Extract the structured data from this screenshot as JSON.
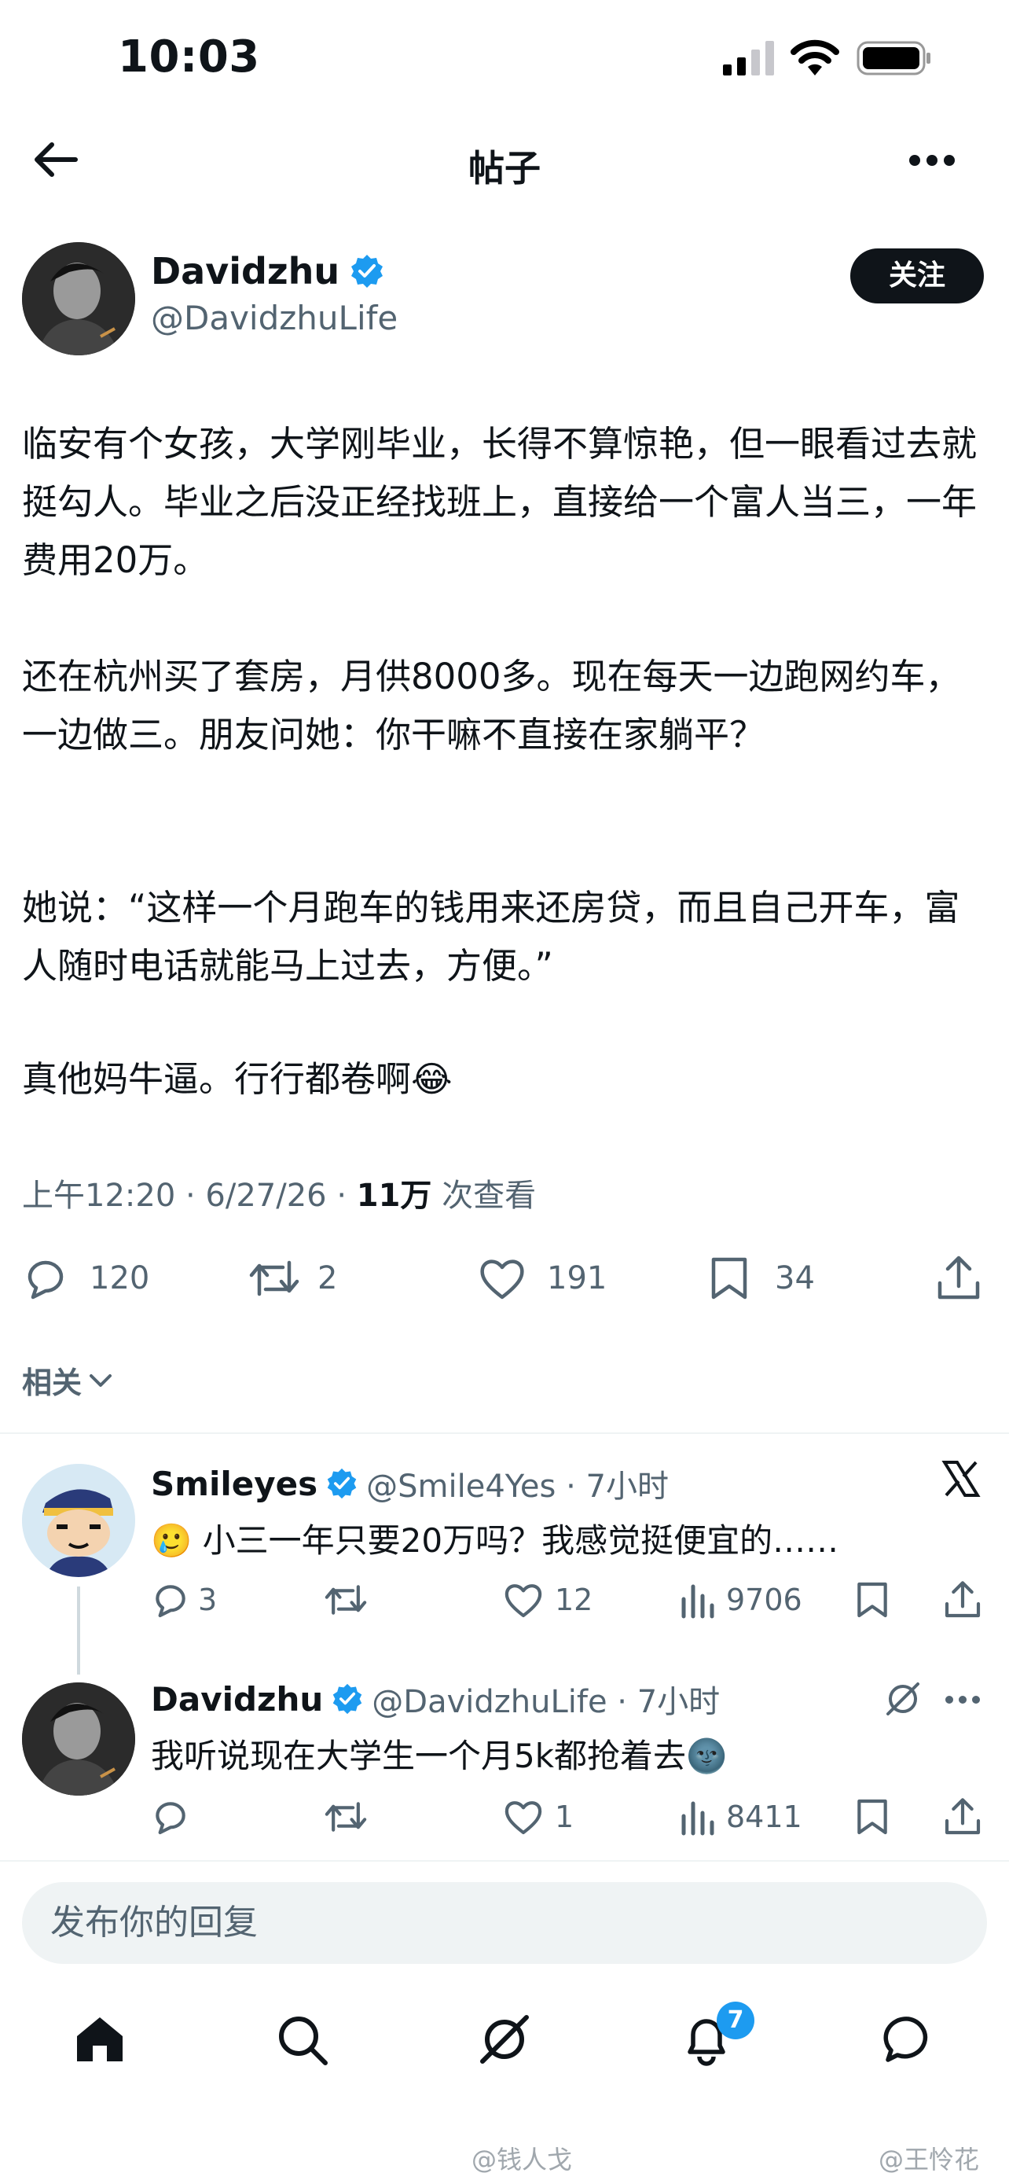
{
  "status_bar": {
    "time": "10:03"
  },
  "header": {
    "title": "帖子"
  },
  "tweet": {
    "author_name": "Davidzhu",
    "author_handle": "@DavidzhuLife",
    "follow_label": "关注",
    "paragraphs": [
      "临安有个女孩，大学刚毕业，长得不算惊艳，但一眼看过去就挺勾人。毕业之后没正经找班上，直接给一个富人当三，一年费用20万。",
      "还在杭州买了套房，月供8000多。现在每天一边跑网约车，一边做三。朋友问她：你干嘛不直接在家躺平？",
      "她说：“这样一个月跑车的钱用来还房贷，而且自己开车，富人随时电话就能马上过去，方便。”",
      "真他妈牛逼。行行都卷啊😂"
    ],
    "meta_time": "上午12:20 · 6/27/26 · ",
    "meta_views": "11万",
    "meta_views_suffix": " 次查看",
    "replies": "120",
    "reposts": "2",
    "likes": "191",
    "bookmarks": "34"
  },
  "related_label": "相关",
  "replies": [
    {
      "name": "Smileyes",
      "handle": "@Smile4Yes · 7小时",
      "text": "🥲 小三一年只要20万吗？我感觉挺便宜的……",
      "replies": "3",
      "reposts": "",
      "likes": "12",
      "views": "9706"
    },
    {
      "name": "Davidzhu",
      "handle": "@DavidzhuLife · 7小时",
      "text": "我听说现在大学生一个月5k都抢着去🌚",
      "replies": "",
      "reposts": "",
      "likes": "1",
      "views": "8411"
    }
  ],
  "reply_box": {
    "placeholder": "发布你的回复"
  },
  "bottom_nav": {
    "notification_count": "7"
  },
  "watermarks": [
    "@钱人戈",
    "@王怜花"
  ],
  "colors": {
    "accent": "#1d9bf0",
    "text": "#0f1419",
    "muted": "#536471"
  }
}
